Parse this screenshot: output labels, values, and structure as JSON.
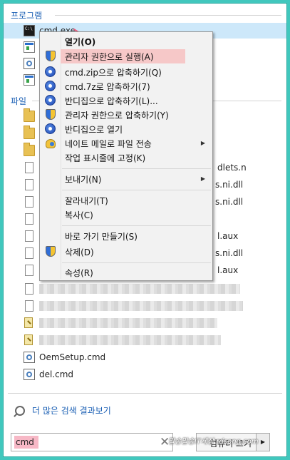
{
  "sections": {
    "programs_header": "프로그램",
    "files_header": "파일"
  },
  "programs": [
    {
      "label": "cmd.exe",
      "icon": "cmd-icon"
    },
    {
      "label": "",
      "icon": "window-icon"
    },
    {
      "label": "",
      "icon": "settings-icon"
    },
    {
      "label": "",
      "icon": "window-icon"
    }
  ],
  "files": [
    {
      "icon": "folder-icon",
      "right_text": ""
    },
    {
      "icon": "folder-icon",
      "right_text": ""
    },
    {
      "icon": "folder-icon",
      "right_text": ""
    },
    {
      "icon": "document-icon",
      "right_text": "dlets.n"
    },
    {
      "icon": "document-icon",
      "right_text": "s.ni.dll"
    },
    {
      "icon": "document-icon",
      "right_text": "s.ni.dll"
    },
    {
      "icon": "document-icon",
      "right_text": ""
    },
    {
      "icon": "document-icon",
      "right_text": "l.aux"
    },
    {
      "icon": "document-icon",
      "right_text": "s.ni.dll"
    },
    {
      "icon": "document-icon",
      "right_text": "l.aux"
    },
    {
      "icon": "document-icon",
      "right_text": ""
    },
    {
      "icon": "document-icon",
      "right_text": ""
    },
    {
      "icon": "key-icon",
      "right_text": ""
    },
    {
      "icon": "key-icon",
      "right_text": ""
    },
    {
      "icon": "setup-icon",
      "label": "OemSetup.cmd"
    },
    {
      "icon": "setup-icon",
      "label": "del.cmd"
    }
  ],
  "context_menu": {
    "items": [
      {
        "label": "열기(O)",
        "icon": "",
        "bold": true
      },
      {
        "label": "관리자 권한으로 실행(A)",
        "icon": "uac-shield-icon",
        "highlighted": true
      },
      {
        "label": "cmd.zip으로 압축하기(Q)",
        "icon": "bandizip-icon"
      },
      {
        "label": "cmd.7z로 압축하기(7)",
        "icon": "bandizip-icon"
      },
      {
        "label": "반디집으로 압축하기(L)...",
        "icon": "bandizip-icon"
      },
      {
        "label": "관리자 권한으로 압축하기(Y)",
        "icon": "uac-shield-icon"
      },
      {
        "label": "반디집으로 열기",
        "icon": "bandizip-icon"
      },
      {
        "label": "네이트 메일로 파일 전송",
        "icon": "nate-icon",
        "submenu": true
      },
      {
        "label": "작업 표시줄에 고정(K)",
        "icon": ""
      },
      {
        "label": "보내기(N)",
        "icon": "",
        "submenu": true
      },
      {
        "label": "잘라내기(T)",
        "icon": ""
      },
      {
        "label": "복사(C)",
        "icon": ""
      },
      {
        "label": "바로 가기 만들기(S)",
        "icon": ""
      },
      {
        "label": "삭제(D)",
        "icon": "uac-shield-icon"
      },
      {
        "label": "속성(R)",
        "icon": ""
      }
    ]
  },
  "more_results": "더 많은 검색 결과보기",
  "search": {
    "value": "cmd",
    "clear_icon": "close-icon"
  },
  "shutdown": {
    "label": "컴퓨터 끄기"
  },
  "watermark": "말송말송IT세상 rdsong.com",
  "colors": {
    "frame": "#41c7bd",
    "highlight": "#f6c8c8",
    "selected": "#cde8fa",
    "link": "#1a5fb4"
  }
}
